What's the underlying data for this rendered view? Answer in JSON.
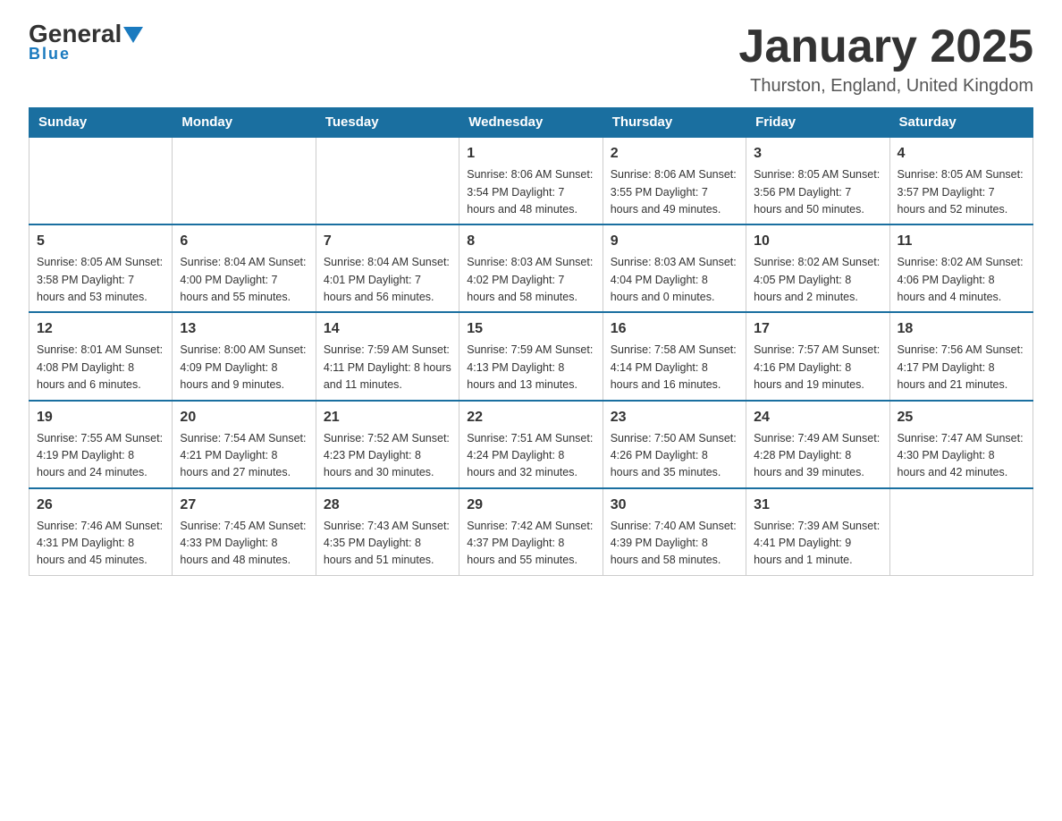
{
  "logo": {
    "general": "General",
    "blue": "Blue"
  },
  "header": {
    "month": "January 2025",
    "location": "Thurston, England, United Kingdom"
  },
  "days_of_week": [
    "Sunday",
    "Monday",
    "Tuesday",
    "Wednesday",
    "Thursday",
    "Friday",
    "Saturday"
  ],
  "weeks": [
    [
      {
        "day": "",
        "info": ""
      },
      {
        "day": "",
        "info": ""
      },
      {
        "day": "",
        "info": ""
      },
      {
        "day": "1",
        "info": "Sunrise: 8:06 AM\nSunset: 3:54 PM\nDaylight: 7 hours\nand 48 minutes."
      },
      {
        "day": "2",
        "info": "Sunrise: 8:06 AM\nSunset: 3:55 PM\nDaylight: 7 hours\nand 49 minutes."
      },
      {
        "day": "3",
        "info": "Sunrise: 8:05 AM\nSunset: 3:56 PM\nDaylight: 7 hours\nand 50 minutes."
      },
      {
        "day": "4",
        "info": "Sunrise: 8:05 AM\nSunset: 3:57 PM\nDaylight: 7 hours\nand 52 minutes."
      }
    ],
    [
      {
        "day": "5",
        "info": "Sunrise: 8:05 AM\nSunset: 3:58 PM\nDaylight: 7 hours\nand 53 minutes."
      },
      {
        "day": "6",
        "info": "Sunrise: 8:04 AM\nSunset: 4:00 PM\nDaylight: 7 hours\nand 55 minutes."
      },
      {
        "day": "7",
        "info": "Sunrise: 8:04 AM\nSunset: 4:01 PM\nDaylight: 7 hours\nand 56 minutes."
      },
      {
        "day": "8",
        "info": "Sunrise: 8:03 AM\nSunset: 4:02 PM\nDaylight: 7 hours\nand 58 minutes."
      },
      {
        "day": "9",
        "info": "Sunrise: 8:03 AM\nSunset: 4:04 PM\nDaylight: 8 hours\nand 0 minutes."
      },
      {
        "day": "10",
        "info": "Sunrise: 8:02 AM\nSunset: 4:05 PM\nDaylight: 8 hours\nand 2 minutes."
      },
      {
        "day": "11",
        "info": "Sunrise: 8:02 AM\nSunset: 4:06 PM\nDaylight: 8 hours\nand 4 minutes."
      }
    ],
    [
      {
        "day": "12",
        "info": "Sunrise: 8:01 AM\nSunset: 4:08 PM\nDaylight: 8 hours\nand 6 minutes."
      },
      {
        "day": "13",
        "info": "Sunrise: 8:00 AM\nSunset: 4:09 PM\nDaylight: 8 hours\nand 9 minutes."
      },
      {
        "day": "14",
        "info": "Sunrise: 7:59 AM\nSunset: 4:11 PM\nDaylight: 8 hours\nand 11 minutes."
      },
      {
        "day": "15",
        "info": "Sunrise: 7:59 AM\nSunset: 4:13 PM\nDaylight: 8 hours\nand 13 minutes."
      },
      {
        "day": "16",
        "info": "Sunrise: 7:58 AM\nSunset: 4:14 PM\nDaylight: 8 hours\nand 16 minutes."
      },
      {
        "day": "17",
        "info": "Sunrise: 7:57 AM\nSunset: 4:16 PM\nDaylight: 8 hours\nand 19 minutes."
      },
      {
        "day": "18",
        "info": "Sunrise: 7:56 AM\nSunset: 4:17 PM\nDaylight: 8 hours\nand 21 minutes."
      }
    ],
    [
      {
        "day": "19",
        "info": "Sunrise: 7:55 AM\nSunset: 4:19 PM\nDaylight: 8 hours\nand 24 minutes."
      },
      {
        "day": "20",
        "info": "Sunrise: 7:54 AM\nSunset: 4:21 PM\nDaylight: 8 hours\nand 27 minutes."
      },
      {
        "day": "21",
        "info": "Sunrise: 7:52 AM\nSunset: 4:23 PM\nDaylight: 8 hours\nand 30 minutes."
      },
      {
        "day": "22",
        "info": "Sunrise: 7:51 AM\nSunset: 4:24 PM\nDaylight: 8 hours\nand 32 minutes."
      },
      {
        "day": "23",
        "info": "Sunrise: 7:50 AM\nSunset: 4:26 PM\nDaylight: 8 hours\nand 35 minutes."
      },
      {
        "day": "24",
        "info": "Sunrise: 7:49 AM\nSunset: 4:28 PM\nDaylight: 8 hours\nand 39 minutes."
      },
      {
        "day": "25",
        "info": "Sunrise: 7:47 AM\nSunset: 4:30 PM\nDaylight: 8 hours\nand 42 minutes."
      }
    ],
    [
      {
        "day": "26",
        "info": "Sunrise: 7:46 AM\nSunset: 4:31 PM\nDaylight: 8 hours\nand 45 minutes."
      },
      {
        "day": "27",
        "info": "Sunrise: 7:45 AM\nSunset: 4:33 PM\nDaylight: 8 hours\nand 48 minutes."
      },
      {
        "day": "28",
        "info": "Sunrise: 7:43 AM\nSunset: 4:35 PM\nDaylight: 8 hours\nand 51 minutes."
      },
      {
        "day": "29",
        "info": "Sunrise: 7:42 AM\nSunset: 4:37 PM\nDaylight: 8 hours\nand 55 minutes."
      },
      {
        "day": "30",
        "info": "Sunrise: 7:40 AM\nSunset: 4:39 PM\nDaylight: 8 hours\nand 58 minutes."
      },
      {
        "day": "31",
        "info": "Sunrise: 7:39 AM\nSunset: 4:41 PM\nDaylight: 9 hours\nand 1 minute."
      },
      {
        "day": "",
        "info": ""
      }
    ]
  ]
}
